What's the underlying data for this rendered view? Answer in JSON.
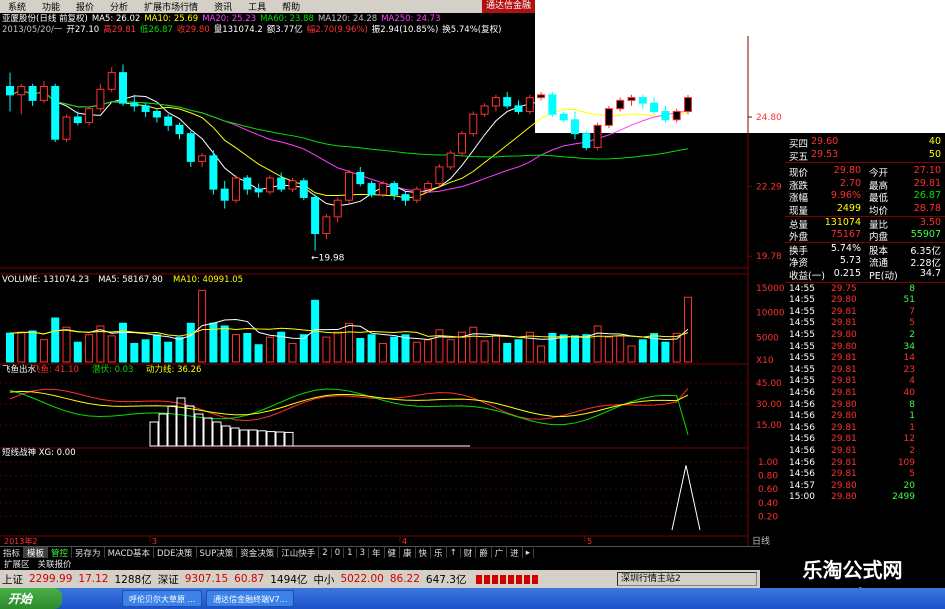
{
  "menu": {
    "items": [
      "系统",
      "功能",
      "报价",
      "分析",
      "扩展市场行情",
      "资讯",
      "工具",
      "帮助"
    ],
    "logo": "通达信金融"
  },
  "header": {
    "line1": [
      {
        "t": "亚厦股份(日线 前复权)",
        "c": "white"
      },
      {
        "t": "MA5: 26.02",
        "c": "white"
      },
      {
        "t": "MA10: 25.69",
        "c": "yellow"
      },
      {
        "t": "MA20: 25.23",
        "c": "mag"
      },
      {
        "t": "MA60: 23.88",
        "c": "green"
      },
      {
        "t": "MA120: 24.28",
        "c": "gray"
      },
      {
        "t": "MA250: 24.73",
        "c": "mag"
      }
    ],
    "line2": [
      {
        "t": "2013/05/20/一",
        "c": "gray"
      },
      {
        "t": "开27.10",
        "c": "white"
      },
      {
        "t": "高29.81",
        "c": "red"
      },
      {
        "t": "低26.87",
        "c": "green"
      },
      {
        "t": "收29.80",
        "c": "red"
      },
      {
        "t": "量131074.2",
        "c": "white"
      },
      {
        "t": "额3.77亿",
        "c": "white"
      },
      {
        "t": "幅2.70(9.96%)",
        "c": "red"
      },
      {
        "t": "振2.94(10.85%)",
        "c": "white"
      },
      {
        "t": "换5.74%(复权)",
        "c": "white"
      }
    ]
  },
  "axes": {
    "price_ticks": [
      "24.80",
      "22.29",
      "19.78"
    ],
    "volume_ticks": [
      "15000",
      "10000",
      "5000",
      "X10"
    ],
    "ind_ticks": [
      "45.00",
      "30.00",
      "15.00"
    ],
    "xg_ticks": [
      "1.00",
      "0.80",
      "0.60",
      "0.40",
      "0.20"
    ],
    "low_label": "←19.98",
    "date_label": "2013年2",
    "date_marks": [
      "3",
      "4",
      "5"
    ],
    "period": "日线"
  },
  "volume_header": [
    {
      "t": "VOLUME: 131074.23",
      "c": "white"
    },
    {
      "t": "MA5: 58167.90",
      "c": "white"
    },
    {
      "t": "MA10: 40991.05",
      "c": "yellow"
    }
  ],
  "ind_header": [
    {
      "t": "飞鱼出水",
      "c": "white"
    },
    {
      "t": "飞鱼: 41.10",
      "c": "red"
    },
    {
      "t": "潜伏: 0.03",
      "c": "green"
    },
    {
      "t": "动力线: 36.26",
      "c": "yellow"
    }
  ],
  "xg_header": [
    {
      "t": "短线战神 XG: 0.00",
      "c": "white"
    }
  ],
  "quote": {
    "top": [
      {
        "label": "买四",
        "price": "29.60",
        "vol": "40"
      },
      {
        "label": "买五",
        "price": "29.53",
        "vol": "50"
      }
    ],
    "stats": [
      [
        "现价",
        "29.80",
        "今开",
        "27.10"
      ],
      [
        "涨跌",
        "2.70",
        "最高",
        "29.81"
      ],
      [
        "涨幅",
        "9.96%",
        "最低",
        "26.87"
      ],
      [
        "现量",
        "2499",
        "均价",
        "28.78"
      ],
      [
        "总量",
        "131074",
        "量比",
        "3.50"
      ],
      [
        "外盘",
        "75167",
        "内盘",
        "55907"
      ],
      [
        "换手",
        "5.74%",
        "股本",
        "6.35亿"
      ],
      [
        "净资",
        "5.73",
        "流通",
        "2.28亿"
      ],
      [
        "收益(一)",
        "0.215",
        "PE(动)",
        "34.7"
      ]
    ],
    "ticks": [
      [
        "14:55",
        "29.75",
        "8",
        "g"
      ],
      [
        "14:55",
        "29.80",
        "51",
        "g"
      ],
      [
        "14:55",
        "29.81",
        "7",
        "r"
      ],
      [
        "14:55",
        "29.81",
        "5",
        "r"
      ],
      [
        "14:55",
        "29.80",
        "2",
        "g"
      ],
      [
        "14:55",
        "29.80",
        "34",
        "g"
      ],
      [
        "14:55",
        "29.81",
        "14",
        "r"
      ],
      [
        "14:55",
        "29.81",
        "23",
        "r"
      ],
      [
        "14:55",
        "29.81",
        "4",
        "r"
      ],
      [
        "14:56",
        "29.81",
        "40",
        "r"
      ],
      [
        "14:56",
        "29.80",
        "8",
        "g"
      ],
      [
        "14:56",
        "29.80",
        "1",
        "g"
      ],
      [
        "14:56",
        "29.81",
        "1",
        "r"
      ],
      [
        "14:56",
        "29.81",
        "12",
        "r"
      ],
      [
        "14:56",
        "29.81",
        "2",
        "r"
      ],
      [
        "14:56",
        "29.81",
        "109",
        "r"
      ],
      [
        "14:56",
        "29.81",
        "5",
        "r"
      ],
      [
        "14:57",
        "29.80",
        "20",
        "g"
      ],
      [
        "15:00",
        "29.80",
        "2499",
        "g"
      ]
    ]
  },
  "tabs": [
    "指标",
    "模板",
    "管控",
    "另存为",
    "MACD基本",
    "DDE决策",
    "SUP决策",
    "资金决策",
    "江山快手",
    "2",
    "0",
    "1",
    "3",
    "年",
    "健",
    "康",
    "快",
    "乐",
    "↑",
    "财",
    "爵",
    "广",
    "进",
    "▸"
  ],
  "tabs2": [
    "扩展区",
    "关联报价"
  ],
  "indexbar": [
    {
      "t": "上证",
      "c": "black"
    },
    {
      "t": "2299.99",
      "c": "red"
    },
    {
      "t": "17.12",
      "c": "red"
    },
    {
      "t": "1288亿",
      "c": "black"
    },
    {
      "t": "深证",
      "c": "black"
    },
    {
      "t": "9307.15",
      "c": "red"
    },
    {
      "t": "60.87",
      "c": "red"
    },
    {
      "t": "1494亿",
      "c": "black"
    },
    {
      "t": "中小",
      "c": "black"
    },
    {
      "t": "5022.00",
      "c": "red"
    },
    {
      "t": "86.22",
      "c": "red"
    },
    {
      "t": "647.3亿",
      "c": "black"
    }
  ],
  "status_right": "深圳行情主站2",
  "taskbar": {
    "start": "开始",
    "buttons": [
      "呼伦贝尔大草原 ...",
      "通达信金融终端V7..."
    ]
  },
  "watermark": {
    "line1": "乐淘公式网",
    "line2": "www.60lt.com"
  },
  "colors": {
    "bg": "#000000",
    "up": "#ff3030",
    "down": "#00ffff",
    "grid": "#800000"
  },
  "chart_data": [
    {
      "type": "candlestick",
      "title": "亚厦股份(日线 前复权)",
      "ohlc": [
        [
          25.9,
          26.4,
          25.0,
          25.6
        ],
        [
          25.6,
          26.0,
          24.9,
          25.9
        ],
        [
          25.9,
          26.0,
          25.2,
          25.4
        ],
        [
          25.4,
          26.1,
          25.3,
          25.9
        ],
        [
          25.9,
          26.0,
          23.9,
          24.0
        ],
        [
          24.0,
          24.9,
          23.9,
          24.8
        ],
        [
          24.8,
          25.0,
          24.5,
          24.6
        ],
        [
          24.6,
          25.2,
          24.5,
          25.1
        ],
        [
          25.1,
          26.0,
          25.0,
          25.8
        ],
        [
          25.8,
          26.6,
          25.7,
          26.4
        ],
        [
          26.4,
          26.7,
          25.2,
          25.3
        ],
        [
          25.3,
          25.6,
          25.0,
          25.2
        ],
        [
          25.2,
          25.3,
          24.8,
          25.0
        ],
        [
          25.0,
          25.1,
          24.6,
          24.8
        ],
        [
          24.8,
          24.9,
          24.3,
          24.5
        ],
        [
          24.5,
          24.6,
          24.0,
          24.2
        ],
        [
          24.2,
          24.3,
          23.0,
          23.2
        ],
        [
          23.2,
          23.5,
          23.0,
          23.4
        ],
        [
          23.4,
          23.6,
          22.0,
          22.2
        ],
        [
          22.2,
          22.5,
          21.5,
          21.8
        ],
        [
          21.8,
          22.7,
          21.7,
          22.6
        ],
        [
          22.6,
          22.7,
          22.0,
          22.2
        ],
        [
          22.2,
          22.4,
          21.9,
          22.1
        ],
        [
          22.1,
          22.7,
          22.0,
          22.6
        ],
        [
          22.6,
          22.8,
          22.1,
          22.2
        ],
        [
          22.2,
          22.6,
          22.1,
          22.5
        ],
        [
          22.5,
          22.6,
          21.8,
          21.9
        ],
        [
          21.9,
          22.0,
          19.98,
          20.6
        ],
        [
          20.6,
          21.3,
          20.4,
          21.2
        ],
        [
          21.2,
          21.9,
          21.0,
          21.8
        ],
        [
          21.8,
          22.9,
          21.7,
          22.8
        ],
        [
          22.8,
          23.0,
          22.3,
          22.4
        ],
        [
          22.4,
          22.5,
          21.9,
          22.0
        ],
        [
          22.0,
          22.5,
          21.9,
          22.4
        ],
        [
          22.4,
          22.5,
          21.8,
          22.0
        ],
        [
          22.0,
          22.1,
          21.6,
          21.8
        ],
        [
          21.8,
          22.3,
          21.7,
          22.2
        ],
        [
          22.2,
          22.5,
          22.1,
          22.4
        ],
        [
          22.4,
          23.1,
          22.3,
          23.0
        ],
        [
          23.0,
          23.6,
          22.9,
          23.5
        ],
        [
          23.5,
          24.3,
          23.4,
          24.2
        ],
        [
          24.2,
          25.0,
          24.1,
          24.9
        ],
        [
          24.9,
          25.3,
          24.8,
          25.2
        ],
        [
          25.2,
          25.6,
          25.0,
          25.5
        ],
        [
          25.5,
          25.7,
          25.1,
          25.2
        ],
        [
          25.2,
          25.4,
          24.9,
          25.0
        ],
        [
          25.0,
          25.6,
          24.9,
          25.5
        ],
        [
          25.5,
          25.7,
          25.4,
          25.6
        ],
        [
          25.6,
          25.7,
          24.8,
          24.9
        ],
        [
          24.9,
          25.0,
          24.6,
          24.7
        ],
        [
          24.7,
          25.0,
          24.0,
          24.2
        ],
        [
          24.2,
          24.3,
          23.6,
          23.7
        ],
        [
          23.7,
          24.6,
          23.6,
          24.5
        ],
        [
          24.5,
          25.2,
          24.4,
          25.1
        ],
        [
          25.1,
          25.5,
          25.0,
          25.4
        ],
        [
          25.4,
          25.6,
          25.2,
          25.5
        ],
        [
          25.5,
          25.6,
          25.1,
          25.3
        ],
        [
          25.3,
          25.5,
          24.9,
          25.0
        ],
        [
          25.0,
          25.2,
          24.6,
          24.7
        ],
        [
          24.7,
          25.1,
          24.6,
          25.0
        ],
        [
          25.0,
          25.6,
          24.9,
          25.5
        ]
      ]
    }
  ]
}
